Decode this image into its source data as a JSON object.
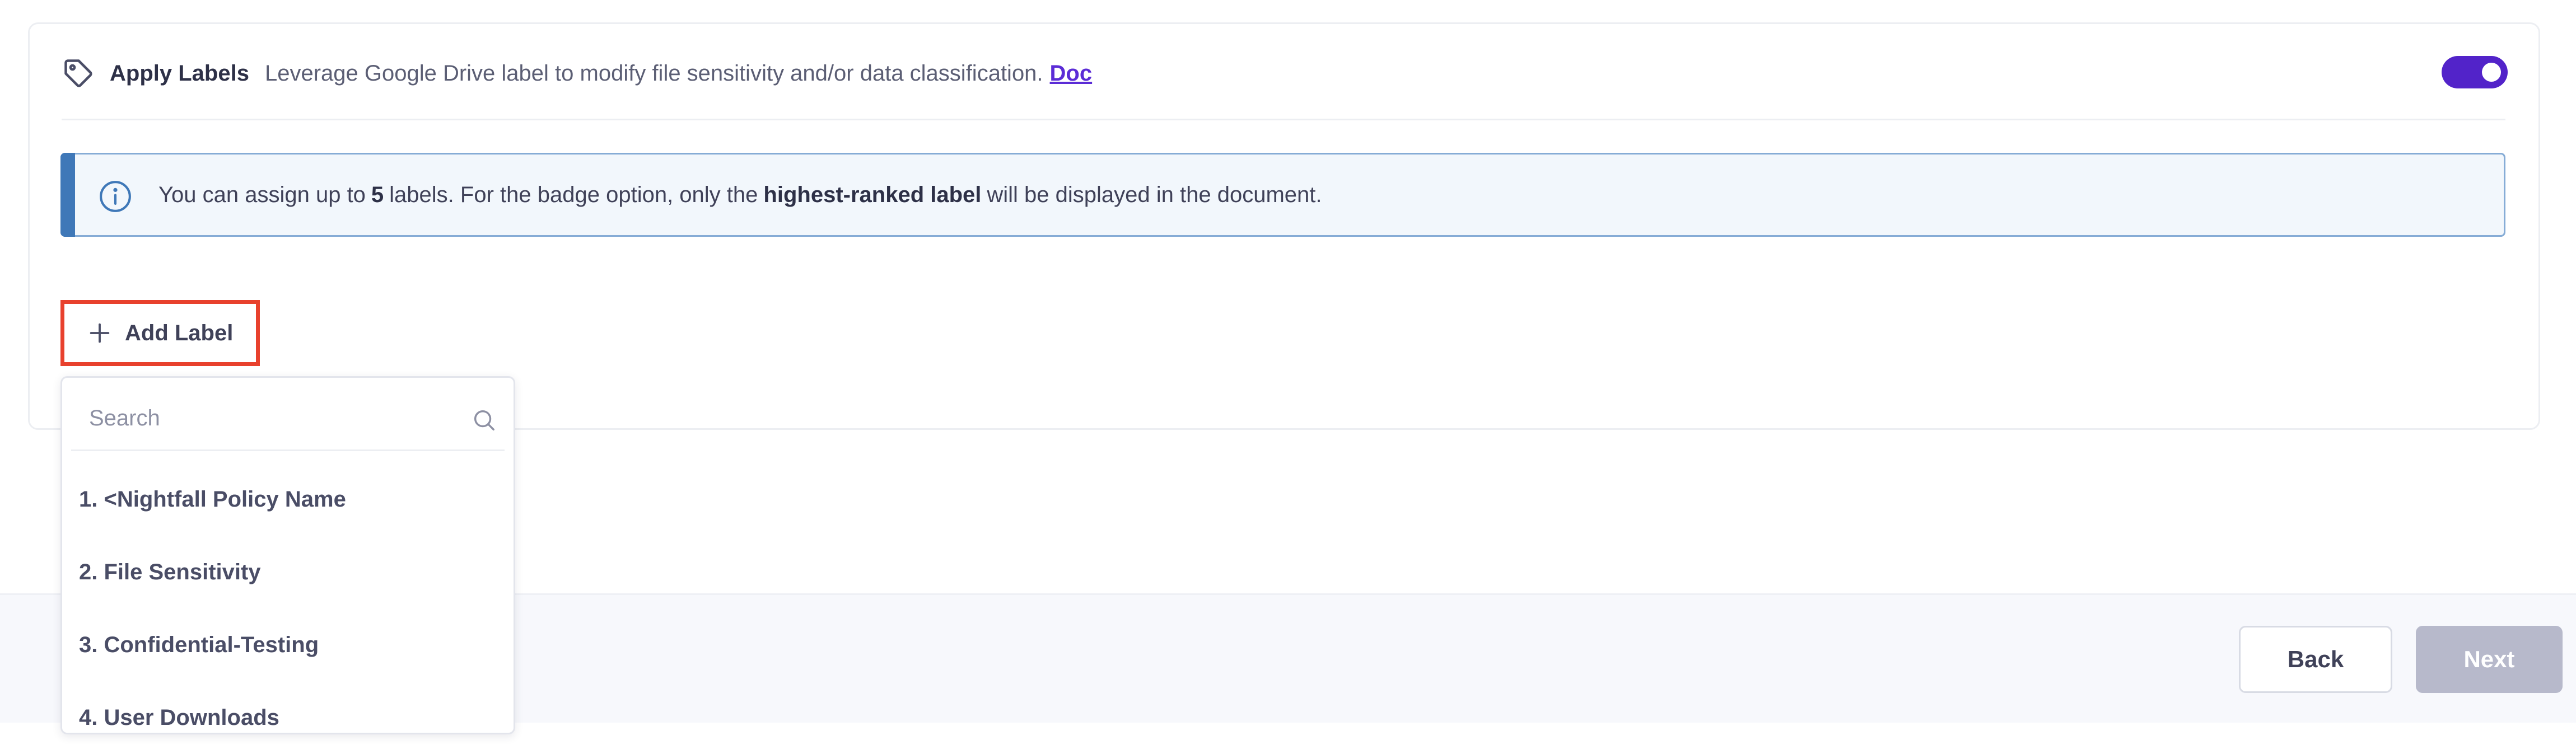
{
  "apply_labels": {
    "icon": "tag-icon",
    "title": "Apply Labels",
    "description": "Leverage Google Drive label to modify file sensitivity and/or data classification.",
    "doc_link": "Doc",
    "toggle_on": true,
    "toggle_color": "#5223c9"
  },
  "info": {
    "icon": "info-icon",
    "text_1": "You can assign up to",
    "count": "5",
    "text_2": "labels. For the badge option, only the",
    "highlight": "highest-ranked label",
    "text_3": "will be displayed in the document."
  },
  "add_label": {
    "icon": "plus-icon",
    "label": "Add Label",
    "highlight_color": "#e8412d"
  },
  "dropdown": {
    "search_placeholder": "Search",
    "search_value": "",
    "options": [
      "1. <Nightfall Policy Name",
      "2. File Sensitivity",
      "3. Confidential-Testing",
      "4. User Downloads"
    ]
  },
  "footer": {
    "back_label": "Back",
    "next_label": "Next",
    "next_disabled": true
  }
}
